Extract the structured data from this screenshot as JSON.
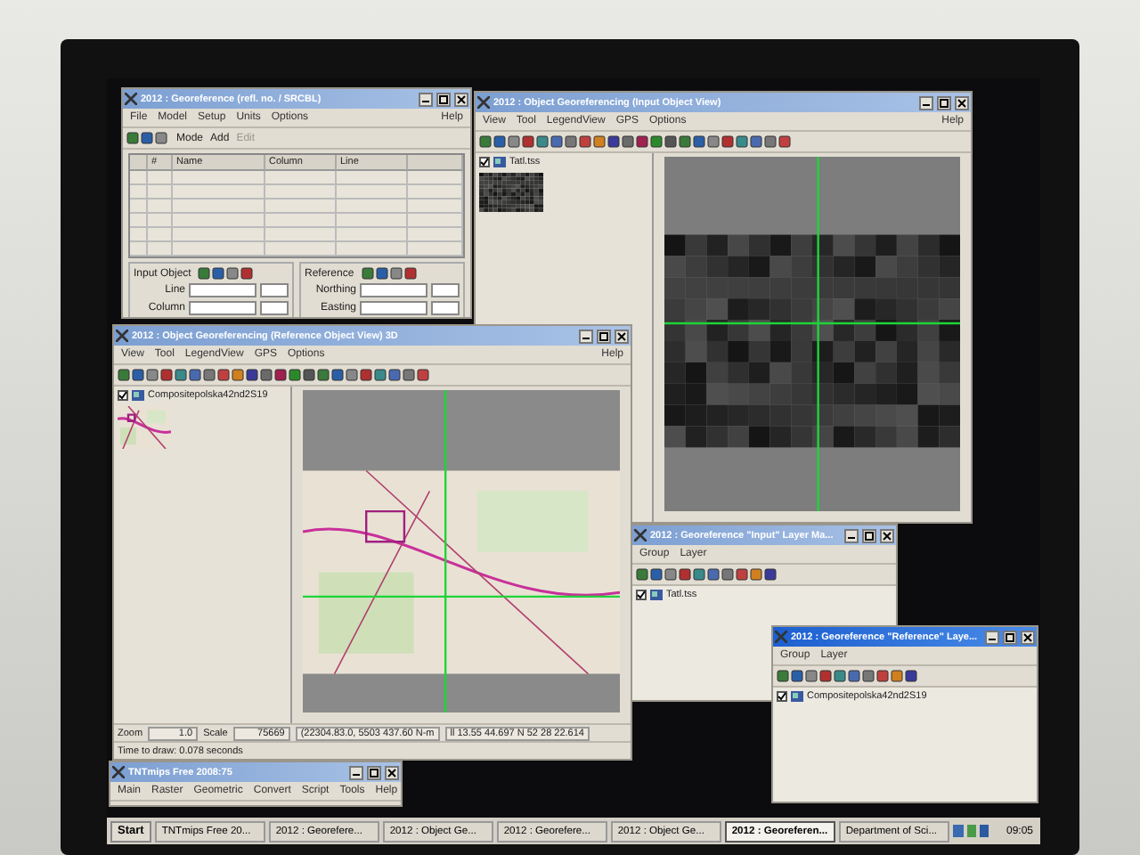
{
  "windows": [
    {
      "kind": "georef",
      "title": "2012 : Georeference (refl. no. / SRCBL)",
      "active": false,
      "menu": [
        "File",
        "Model",
        "Setup",
        "Units",
        "Options"
      ],
      "help": "Help",
      "toolbar": [
        {
          "label": "Mode",
          "disabled": false
        },
        {
          "label": "Add",
          "disabled": false
        },
        {
          "label": "Edit",
          "disabled": true
        }
      ],
      "columns": [
        "#",
        "Name",
        "Column",
        "Line"
      ],
      "panels": [
        {
          "title": "Input Object",
          "fields": [
            "Line",
            "Column"
          ]
        },
        {
          "title": "Reference",
          "fields": [
            "Northing",
            "Easting"
          ]
        }
      ]
    },
    {
      "kind": "input_view",
      "title": "2012 : Object Georeferencing (Input Object View)",
      "active": false,
      "menu": [
        "View",
        "Tool",
        "LegendView",
        "GPS",
        "Options"
      ],
      "help": "Help",
      "tree": [
        {
          "label": "Tatl.tss",
          "checked": true
        }
      ]
    },
    {
      "kind": "reference_view",
      "title": "2012 : Object Georeferencing (Reference Object View) 3D",
      "active": false,
      "menu": [
        "View",
        "Tool",
        "LegendView",
        "GPS",
        "Options"
      ],
      "help": "Help",
      "tree": [
        {
          "label": "Compositepolska42nd2S19",
          "checked": true
        }
      ],
      "status": {
        "zoom_label": "Zoom",
        "zoom": "1.0",
        "scale_label": "Scale",
        "scale": "75669",
        "coords": "(22304.83.0, 5503 437.60 N-m",
        "latlon": "ll 13.55 44.697 N 52 28 22.614",
        "message": "Time to draw: 0.078 seconds"
      }
    },
    {
      "kind": "app",
      "title": "TNTmips Free 2008:75",
      "active": false,
      "menu": [
        "Main",
        "Raster",
        "Geometric",
        "Convert",
        "Script",
        "Tools",
        "Help"
      ]
    },
    {
      "kind": "layers",
      "title": "2012 : Georeference \"Input\" Layer Ma...",
      "active": false,
      "menu": [
        "Group",
        "Layer"
      ],
      "tree": [
        {
          "label": "Tatl.tss",
          "checked": true
        }
      ]
    },
    {
      "kind": "layers",
      "title": "2012 : Georeference \"Reference\" Laye...",
      "active": true,
      "menu": [
        "Group",
        "Layer"
      ],
      "tree": [
        {
          "label": "Compositepolska42nd2S19",
          "checked": true
        }
      ]
    }
  ],
  "taskbar": {
    "start": "Start",
    "items": [
      {
        "label": "TNTmips Free 20...",
        "selected": false
      },
      {
        "label": "2012 : Georefere...",
        "selected": false
      },
      {
        "label": "2012 : Object Ge...",
        "selected": false
      },
      {
        "label": "2012 : Georefere...",
        "selected": false
      },
      {
        "label": "2012 : Object Ge...",
        "selected": false
      },
      {
        "label": "2012 : Georeferen...",
        "selected": true
      },
      {
        "label": "Department of Sci...",
        "selected": false
      }
    ],
    "clock": "09:05"
  }
}
